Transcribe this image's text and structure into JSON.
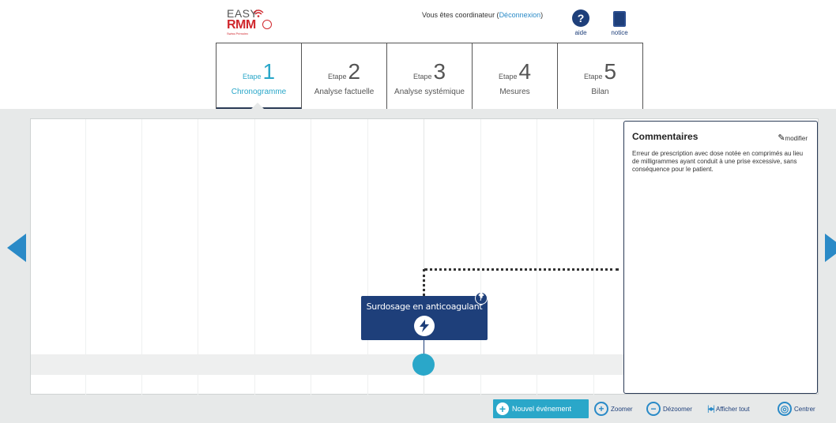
{
  "header": {
    "logo": {
      "line1": "EASY",
      "line2": "RMM",
      "sub": "Swiss Primoinv"
    },
    "user_text": "Vous êtes coordinateur (",
    "logout_label": "Déconnexion",
    "user_text_end": ")",
    "aide_label": "aide",
    "aide_glyph": "?",
    "notice_label": "notice"
  },
  "tabs": [
    {
      "word": "Etape",
      "number": "1",
      "name": "Chronogramme",
      "active": true
    },
    {
      "word": "Etape",
      "number": "2",
      "name": "Analyse factuelle",
      "active": false
    },
    {
      "word": "Etape",
      "number": "3",
      "name": "Analyse systémique",
      "active": false
    },
    {
      "word": "Etape",
      "number": "4",
      "name": "Mesures",
      "active": false
    },
    {
      "word": "Etape",
      "number": "5",
      "name": "Bilan",
      "active": false
    }
  ],
  "timeline": {
    "event": {
      "title": "Surdosage en anticoagulant",
      "icon": "lightning-icon"
    }
  },
  "comments": {
    "title": "Commentaires",
    "edit_label": "modifier",
    "text": "Erreur de prescription avec dose notée en comprimés au lieu de milligrammes ayant conduit à une prise excessive, sans conséquence pour le patient."
  },
  "toolbar": {
    "new_event": "Nouvel événement",
    "zoom": "Zoomer",
    "dezoom": "Dézoomer",
    "show_all": "Afficher tout",
    "center": "Centrer"
  },
  "colors": {
    "accent": "#2aa7c9",
    "navy": "#1e3f7a",
    "link": "#2a8ac7",
    "brand_red": "#d0282e"
  }
}
